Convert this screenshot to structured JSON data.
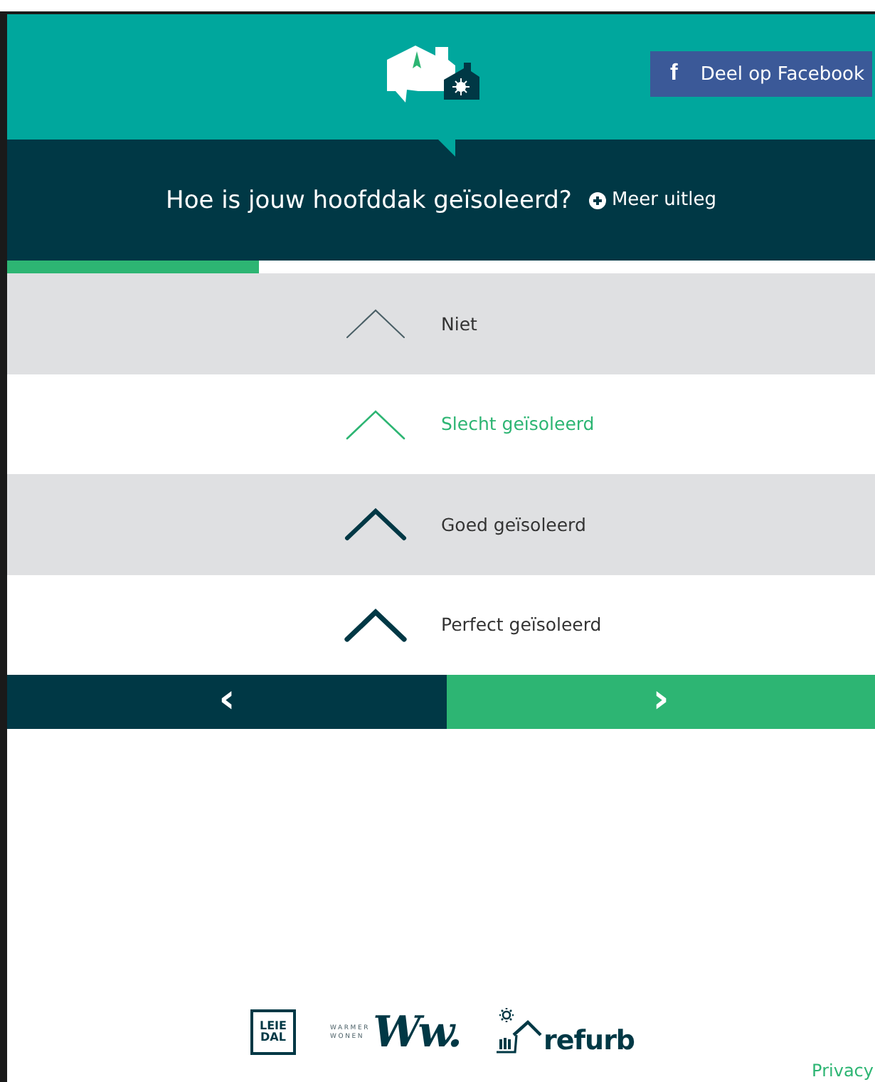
{
  "header": {
    "share_button": {
      "icon": "f",
      "label": "Deel op Facebook"
    }
  },
  "question": {
    "title": "Hoe is jouw hoofddak geïsoleerd?",
    "more_link": "Meer uitleg"
  },
  "progress": {
    "level": 0.29
  },
  "options": [
    {
      "label": "Niet",
      "kind": "none",
      "selected": false
    },
    {
      "label": "Slecht geïsoleerd",
      "kind": "poor",
      "selected": true
    },
    {
      "label": "Goed geïsoleerd",
      "kind": "good",
      "selected": false
    },
    {
      "label": "Perfect geïsoleerd",
      "kind": "perfect",
      "selected": false
    }
  ],
  "navigation": {
    "previous": "‹",
    "next": "›"
  },
  "footer": {
    "logos": [
      {
        "kind": "leiedal",
        "lines": [
          "LEIE",
          "DAL"
        ]
      },
      {
        "kind": "warmer-wonen",
        "lines": [
          "WARMER",
          "WONEN"
        ],
        "mark": "Ww."
      },
      {
        "kind": "refurb",
        "lines": [
          "refurb"
        ]
      }
    ],
    "privacy_link": "Privacy"
  }
}
